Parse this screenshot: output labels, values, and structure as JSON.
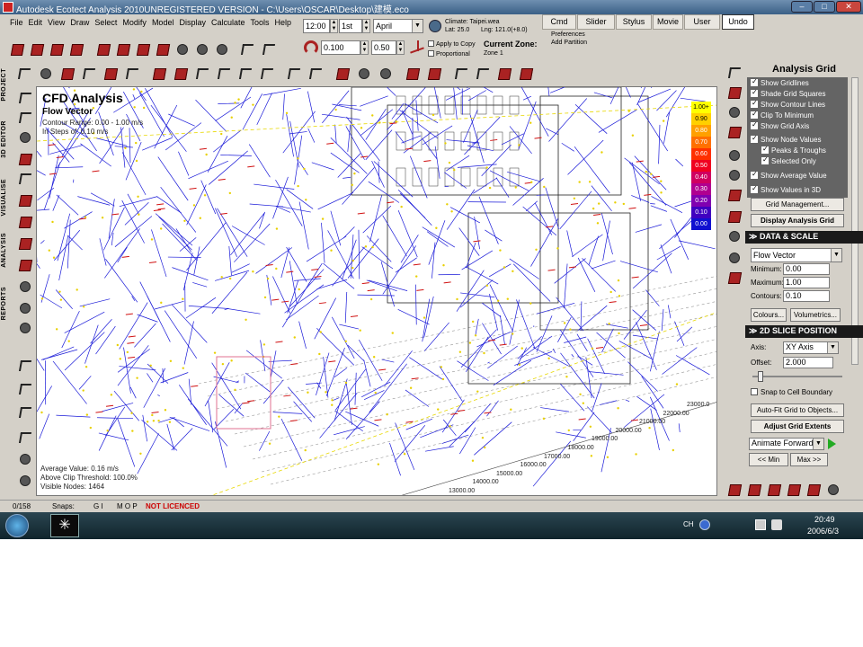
{
  "window": {
    "title": "Autodesk Ecotect Analysis 2010UNREGISTERED VERSION - C:\\Users\\OSCAR\\Desktop\\建模.eco",
    "minimize": "–",
    "maximize": "□",
    "close": "✕"
  },
  "menu": [
    "File",
    "Edit",
    "View",
    "Draw",
    "Select",
    "Modify",
    "Model",
    "Display",
    "Calculate",
    "Tools",
    "Help"
  ],
  "time_controls": {
    "time": "12:00",
    "day": "1st",
    "month": "April",
    "climate": "Climate: Taipei.wea",
    "lat": "Lat: 25.0",
    "lng": "Lng: 121.0(+8.0)",
    "value_a": "0.100",
    "value_b": "0.50",
    "apply_to_copy": "Apply to Copy",
    "proportional": "Proportional",
    "current_zone_label": "Current Zone:",
    "current_zone": "Zone 1"
  },
  "top_tabs": [
    "Cmd",
    "Slider",
    "Stylus",
    "Movie",
    "User",
    "Undo"
  ],
  "top_links": [
    "Preferences",
    "Add Partition"
  ],
  "left_vertical_tabs": [
    "PROJECT",
    "3D EDITOR",
    "VISUALISE",
    "ANALYSIS",
    "REPORTS"
  ],
  "viewport": {
    "title": "CFD Analysis",
    "subtitle": "Flow Vector",
    "contour_range": "Contour Range: 0.00 - 1.00 m/s",
    "steps": "In Steps of: 0.10 m/s",
    "average": "Average Value: 0.16 m/s",
    "above_clip": "Above Clip Threshold: 100.0%",
    "visible_nodes": "Visible Nodes: 1464",
    "axis_ticks": [
      "13000.00",
      "14000.00",
      "15000.00",
      "16000.00",
      "17000.00",
      "18000.00",
      "19000.00",
      "20000.00",
      "21000.00",
      "22000.00",
      "23000.0"
    ]
  },
  "legend": {
    "values": [
      "1.00+",
      "0.90",
      "0.80",
      "0.70",
      "0.60",
      "0.50",
      "0.40",
      "0.30",
      "0.20",
      "0.10",
      "0.00"
    ],
    "colors": [
      "#ffff00",
      "#ffd000",
      "#ffa000",
      "#ff7000",
      "#ff3000",
      "#f00020",
      "#d00060",
      "#b00090",
      "#8000b0",
      "#4000c0",
      "#1010d0"
    ]
  },
  "panel": {
    "title": "Analysis Grid",
    "checkboxes": [
      {
        "label": "Show Gridlines",
        "checked": true
      },
      {
        "label": "Shade Grid Squares",
        "checked": true
      },
      {
        "label": "Show Contour Lines",
        "checked": true
      },
      {
        "label": "Clip To Minimum",
        "checked": true
      },
      {
        "label": "Show Grid Axis",
        "checked": true
      },
      {
        "label": "Show Node Values",
        "checked": true
      },
      {
        "label": "Peaks & Troughs",
        "checked": true
      },
      {
        "label": "Selected Only",
        "checked": true
      },
      {
        "label": "Show Average Value",
        "checked": true
      },
      {
        "label": "Show Values in 3D",
        "checked": true
      }
    ],
    "grid_management": "Grid Management...",
    "display_analysis_grid": "Display Analysis Grid",
    "data_scale_header": "DATA & SCALE",
    "data_type": "Flow Vector",
    "minimum_label": "Minimum:",
    "minimum": "0.00",
    "maximum_label": "Maximum:",
    "maximum": "1.00",
    "contours_label": "Contours:",
    "contours": "0.10",
    "colours_btn": "Colours...",
    "volumetrics_btn": "Volumetrics...",
    "slice_header": "2D SLICE POSITION",
    "axis_label": "Axis:",
    "axis": "XY Axis",
    "offset_label": "Offset:",
    "offset": "2.000",
    "snap_label": "Snap to Cell Boundary",
    "autofit_btn": "Auto-Fit Grid to Objects...",
    "adjust_btn": "Adjust Grid Extents",
    "animate": "Animate Forwards",
    "min_btn": "<< Min",
    "max_btn": "Max >>"
  },
  "status": {
    "count": "0/158",
    "snaps": "Snaps:",
    "gi": "G I",
    "mop": "M O P",
    "licence": "NOT LICENCED"
  },
  "taskbar": {
    "lang": "CH",
    "time": "20:49",
    "date": "2006/6/3"
  }
}
